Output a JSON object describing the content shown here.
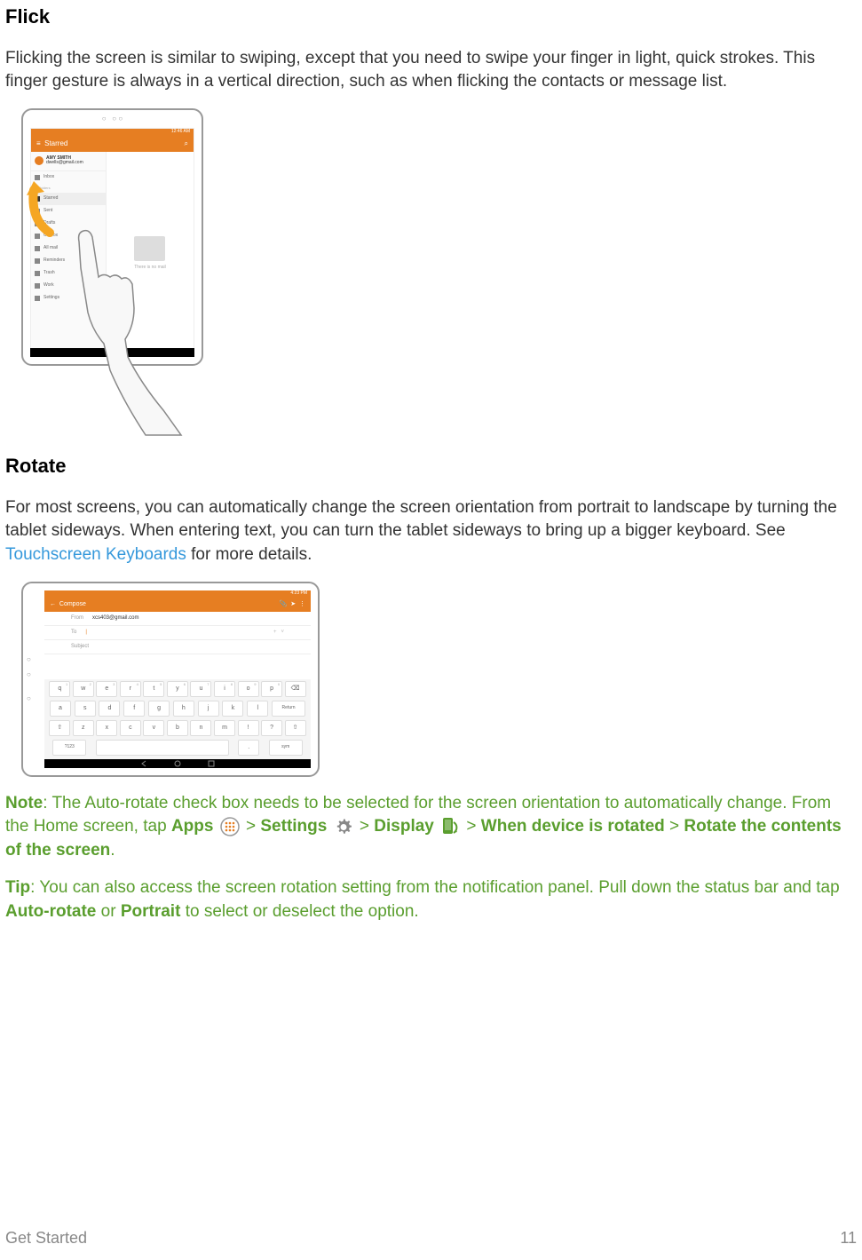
{
  "sections": {
    "flick": {
      "heading": "Flick",
      "body": "Flicking the screen is similar to swiping, except that you need to swipe your finger in light, quick strokes. This finger gesture is always in a vertical direction, such as when flicking the contacts or message list."
    },
    "rotate": {
      "heading": "Rotate",
      "body_pre": "For most screens, you can automatically change the screen orientation from portrait to landscape by turning the tablet sideways. When entering text, you can turn the tablet sideways to bring up a bigger keyboard. See ",
      "body_link": "Touchscreen Keyboards",
      "body_post": " for more details."
    }
  },
  "note": {
    "label": "Note",
    "line1": ": The Auto-rotate check box needs to be selected for the screen orientation to automatically change. ",
    "line2a": "From the Home screen, tap ",
    "apps": "Apps",
    "gt1": " > ",
    "settings": "Settings",
    "gt2": " > ",
    "display": "Display",
    "gt3": " > ",
    "when_rotated": "When device is rotated",
    "gt4": " > ",
    "rotate_contents": "Rotate the contents of the screen",
    "period": "."
  },
  "tip": {
    "label": "Tip",
    "body_pre": ": You can also access the screen rotation setting from the notification panel. Pull down the status bar and tap ",
    "auto_rotate": "Auto-rotate",
    "or": " or ",
    "portrait": "Portrait",
    "body_post": " to select or deselect the option."
  },
  "flick_screen": {
    "status_time": "12:46 AM",
    "header_title": "Starred",
    "user_name": "AMY SMITH",
    "user_email": "dwells@gmail.com",
    "sidebar_items": [
      "Inbox",
      "Starred",
      "Sent",
      "Drafts",
      "Outbox",
      "All mail",
      "Reminders",
      "Trash",
      "Work",
      "Settings"
    ],
    "empty_text": "There is no mail"
  },
  "rotate_screen": {
    "status_time": "4:23 PM",
    "compose_title": "Compose",
    "from_label": "From",
    "from_value": "xcs403@gmail.com",
    "to_label": "To",
    "subject_label": "Subject",
    "keyboard_rows": [
      {
        "keys": [
          "q",
          "w",
          "e",
          "r",
          "t",
          "y",
          "u",
          "i",
          "o",
          "p",
          "⌫"
        ],
        "nums": [
          "1",
          "2",
          "3",
          "4",
          "5",
          "6",
          "7",
          "8",
          "9",
          "0",
          ""
        ]
      },
      {
        "keys": [
          "a",
          "s",
          "d",
          "f",
          "g",
          "h",
          "j",
          "k",
          "l",
          "Return"
        ],
        "nums": []
      },
      {
        "keys": [
          "⇧",
          "z",
          "x",
          "c",
          "v",
          "b",
          "n",
          "m",
          "!",
          "?",
          "⇧"
        ],
        "nums": []
      },
      {
        "keys": [
          "?123",
          "",
          "",
          "",
          "",
          "",
          ".",
          "sym"
        ],
        "nums": []
      }
    ]
  },
  "footer": {
    "section": "Get Started",
    "page": "11"
  }
}
